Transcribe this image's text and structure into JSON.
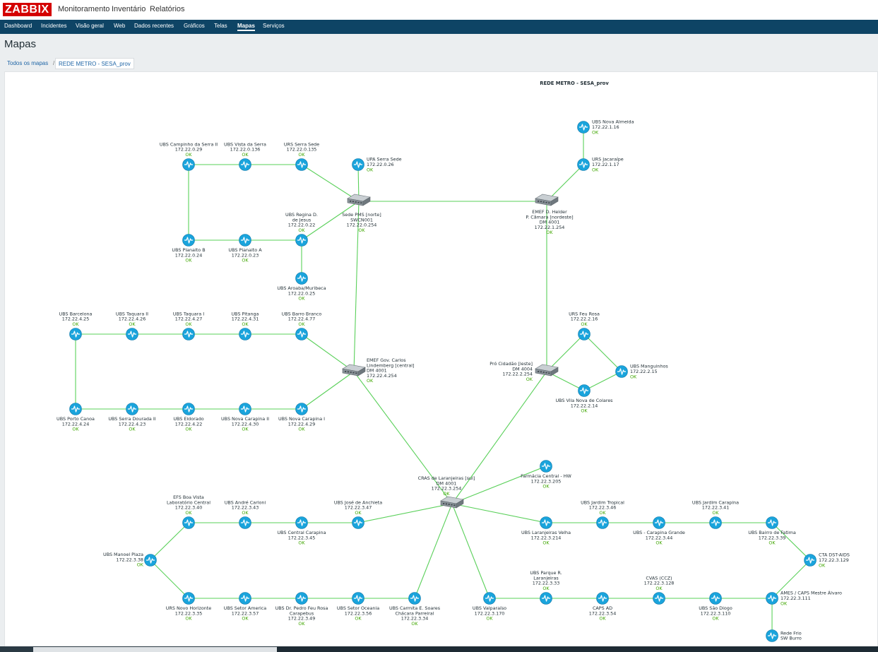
{
  "app": {
    "logo": "ZABBIX",
    "top_menu": [
      "Monitoramento",
      "Inventário",
      "Relatórios"
    ],
    "sub_menu": [
      "Dashboard",
      "Incidentes",
      "Visão geral",
      "Web",
      "Dados recentes",
      "Gráficos",
      "Telas",
      "Mapas",
      "Serviços"
    ],
    "active_sub": "Mapas"
  },
  "page": {
    "title": "Mapas",
    "breadcrumb_all": "Todos os mapas",
    "breadcrumb_sep": "/",
    "breadcrumb_current": "REDE METRO - SESA_prov"
  },
  "map": {
    "title": "REDE METRO - SESA_prov",
    "colors": {
      "link": "#5ad05a",
      "node": "#1aa4dc",
      "ok": "#3fa600",
      "switch": "#8a9399"
    },
    "nodes": [
      {
        "id": "sede",
        "kind": "switch",
        "label": [
          "Sede PMS [norte]",
          "SWCN001",
          "172.22.0.254"
        ],
        "status": "OK"
      },
      {
        "id": "emef_helder",
        "kind": "switch",
        "label": [
          "EMEF D. Helder",
          "P. Câmara [nordeste]",
          "DM 4001",
          "172.22.1.254"
        ],
        "status": "OK"
      },
      {
        "id": "emef_carlos",
        "kind": "switch",
        "label": [
          "EMEF Gov. Carlos",
          "Lindemberg [central]",
          "DM 4001",
          "172.22.4.254"
        ],
        "status": "OK"
      },
      {
        "id": "pro_cidadao",
        "kind": "switch",
        "label": [
          "Pró Cidadão [leste]",
          "DM 4004",
          "172.22.2.254"
        ],
        "status": "OK"
      },
      {
        "id": "cras",
        "kind": "switch",
        "label": [
          "CRAS de Laranjeiras [sul]",
          "DM 4001",
          "172.22.3.254"
        ],
        "status": "OK"
      },
      {
        "id": "ubs_campinho",
        "kind": "host",
        "label": [
          "UBS Campinho da Serra II",
          "172.22.0.29"
        ],
        "status": "OK"
      },
      {
        "id": "ubs_vista",
        "kind": "host",
        "label": [
          "UBS Vista da Serra",
          "172.22.0.136"
        ],
        "status": "OK"
      },
      {
        "id": "urs_serra_sede",
        "kind": "host",
        "label": [
          "URS Serra Sede",
          "172.22.0.135"
        ],
        "status": "OK"
      },
      {
        "id": "upa_serra_sede",
        "kind": "host",
        "label": [
          "UPA Serra Sede",
          "172.22.0.26"
        ],
        "status": "OK"
      },
      {
        "id": "ubs_regina",
        "kind": "host",
        "label": [
          "UBS Regina D.",
          "de Jesus",
          "172.22.0.22"
        ],
        "status": "OK"
      },
      {
        "id": "ubs_planalto_b",
        "kind": "host",
        "label": [
          "UBS Planalto B",
          "172.22.0.24"
        ],
        "status": "OK"
      },
      {
        "id": "ubs_planalto_a",
        "kind": "host",
        "label": [
          "UBS Planalto A",
          "172.22.0.23"
        ],
        "status": "OK"
      },
      {
        "id": "ubs_aroaba",
        "kind": "host",
        "label": [
          "UBS Aroaba/Muribeca",
          "172.22.0.25"
        ],
        "status": "OK"
      },
      {
        "id": "ubs_nova_almeida",
        "kind": "host",
        "label": [
          "UBS Nova Almeida",
          "172.22.1.16"
        ],
        "status": "OK"
      },
      {
        "id": "urs_jacaraipe",
        "kind": "host",
        "label": [
          "URS Jacaraípe",
          "172.22.1.17"
        ],
        "status": "OK"
      },
      {
        "id": "ubs_barcelona",
        "kind": "host",
        "label": [
          "UBS Barcelona",
          "172.22.4.25"
        ],
        "status": "OK"
      },
      {
        "id": "ubs_taquara2",
        "kind": "host",
        "label": [
          "UBS Taquara II",
          "172.22.4.26"
        ],
        "status": "OK"
      },
      {
        "id": "ubs_taquara1",
        "kind": "host",
        "label": [
          "UBS Taquara I",
          "172.22.4.27"
        ],
        "status": "OK"
      },
      {
        "id": "ubs_pitanga",
        "kind": "host",
        "label": [
          "UBS Pitanga",
          "172.22.4.31"
        ],
        "status": "OK"
      },
      {
        "id": "ubs_barro_branco",
        "kind": "host",
        "label": [
          "UBS Barro Branco",
          "172.22.4.77"
        ],
        "status": "OK"
      },
      {
        "id": "ubs_porto_canoa",
        "kind": "host",
        "label": [
          "UBS Porto Canoa",
          "172.22.4.24"
        ],
        "status": "OK"
      },
      {
        "id": "ubs_serra_dourada",
        "kind": "host",
        "label": [
          "UBS Serra Dourada II",
          "172.22.4.23"
        ],
        "status": "OK"
      },
      {
        "id": "ubs_eldorado",
        "kind": "host",
        "label": [
          "UBS Eldorado",
          "172.22.4.22"
        ],
        "status": "OK"
      },
      {
        "id": "ubs_nova_carapina2",
        "kind": "host",
        "label": [
          "UBS Nova Carapina II",
          "172.22.4.30"
        ],
        "status": "OK"
      },
      {
        "id": "ubs_nova_carapina1",
        "kind": "host",
        "label": [
          "UBS Nova Carapina I",
          "172.22.4.29"
        ],
        "status": "OK"
      },
      {
        "id": "urs_feu_rosa",
        "kind": "host",
        "label": [
          "URS Feu Rosa",
          "172.22.2.16"
        ],
        "status": "OK"
      },
      {
        "id": "ubs_manguinhos",
        "kind": "host",
        "label": [
          "UBS Manguinhos",
          "172.22.2.15"
        ],
        "status": "OK"
      },
      {
        "id": "ubs_vila_nova",
        "kind": "host",
        "label": [
          "UBS Vila Nova de Colares",
          "172.22.2.14"
        ],
        "status": "OK"
      },
      {
        "id": "farmacia",
        "kind": "host",
        "label": [
          "Farmácia Central - HW",
          "172.22.3.205"
        ],
        "status": "OK"
      },
      {
        "id": "efs_boa_vista",
        "kind": "host",
        "label": [
          "EFS Boa Vista",
          "Laboratório Central",
          "172.22.3.40"
        ],
        "status": "OK"
      },
      {
        "id": "ubs_andre",
        "kind": "host",
        "label": [
          "UBS André Carloni",
          "172.22.3.43"
        ],
        "status": "OK"
      },
      {
        "id": "ubs_jose",
        "kind": "host",
        "label": [
          "UBS José de Anchieta",
          "172.22.3.47"
        ],
        "status": "OK"
      },
      {
        "id": "ubs_central_carapina",
        "kind": "host",
        "label": [
          "UBS Central Carapina",
          "172.22.3.45"
        ],
        "status": "OK"
      },
      {
        "id": "ubs_manoel",
        "kind": "host",
        "label": [
          "UBS Manoel Plaza",
          "172.22.3.38"
        ],
        "status": "OK"
      },
      {
        "id": "urs_novo_horizonte",
        "kind": "host",
        "label": [
          "URS Novo Horizonte",
          "172.22.3.35"
        ],
        "status": "OK"
      },
      {
        "id": "ubs_setor_america",
        "kind": "host",
        "label": [
          "UBS Setor America",
          "172.22.3.57"
        ],
        "status": "OK"
      },
      {
        "id": "ubs_pedro",
        "kind": "host",
        "label": [
          "UBS Dr. Pedro Feu Rosa",
          "Carapebus",
          "172.22.3.49"
        ],
        "status": "OK"
      },
      {
        "id": "ubs_setor_oceania",
        "kind": "host",
        "label": [
          "UBS Setor Oceania",
          "172.22.3.56"
        ],
        "status": "OK"
      },
      {
        "id": "ubs_carmita",
        "kind": "host",
        "label": [
          "UBS Carmita E. Soares",
          "Chácara Parreiral",
          "172.22.3.34"
        ],
        "status": "OK"
      },
      {
        "id": "ubs_valparaiso",
        "kind": "host",
        "label": [
          "UBS Valparaíso",
          "172.22.3.170"
        ],
        "status": "OK"
      },
      {
        "id": "ubs_laranjeiras_velha",
        "kind": "host",
        "label": [
          "UBS Laranjeiras Velha",
          "172.22.3.214"
        ],
        "status": "OK"
      },
      {
        "id": "ubs_jardim_tropical",
        "kind": "host",
        "label": [
          "UBS Jardim Tropical",
          "172.22.3.46"
        ],
        "status": "OK"
      },
      {
        "id": "ubs_carapina_grande",
        "kind": "host",
        "label": [
          "UBS - Carapina Grande",
          "172.22.3.44"
        ],
        "status": "OK"
      },
      {
        "id": "ubs_jardim_carapina",
        "kind": "host",
        "label": [
          "UBS Jardim Carapina",
          "172.22.3.41"
        ],
        "status": "OK"
      },
      {
        "id": "ubs_bairro_fatima",
        "kind": "host",
        "label": [
          "UBS Bairro de Fatima",
          "172.22.3.39"
        ],
        "status": "OK"
      },
      {
        "id": "cta_dst",
        "kind": "host",
        "label": [
          "CTA DST-AIDS",
          "172.22.3.129"
        ],
        "status": "OK"
      },
      {
        "id": "ames",
        "kind": "host",
        "label": [
          "AMES / CAPS Mestre Álvaro",
          "172.22.3.111"
        ],
        "status": "OK"
      },
      {
        "id": "rede_frio",
        "kind": "host",
        "label": [
          "Rede Frio",
          "SW Burro"
        ],
        "status": ""
      },
      {
        "id": "ubs_parque",
        "kind": "host",
        "label": [
          "UBS Parque R.",
          "Laranjeiras",
          "172.22.3.33"
        ],
        "status": "OK"
      },
      {
        "id": "caps_ad",
        "kind": "host",
        "label": [
          "CAPS AD",
          "172.22.3.54"
        ],
        "status": "OK"
      },
      {
        "id": "cvas",
        "kind": "host",
        "label": [
          "CVAS (CCZ)",
          "172.22.3.128"
        ],
        "status": "OK"
      },
      {
        "id": "ubs_sao_diogo",
        "kind": "host",
        "label": [
          "UBS São Diogo",
          "172.22.3.110"
        ],
        "status": "OK"
      }
    ]
  }
}
